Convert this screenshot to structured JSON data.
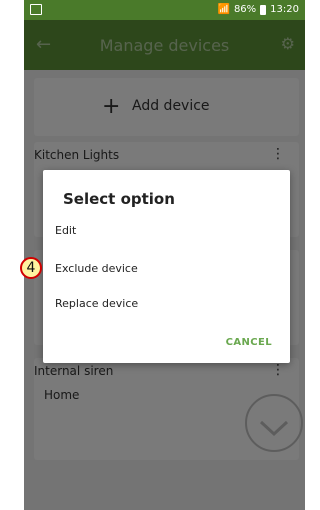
{
  "statusbar": {
    "signal": " .▎",
    "battery_pct": "86%",
    "time": "13:20"
  },
  "appbar": {
    "title": "Manage devices",
    "back_icon": "arrow-back-icon",
    "settings_icon": "gear-icon"
  },
  "add_device": {
    "label": "Add device",
    "icon": "plus-icon"
  },
  "cards": [
    {
      "title": "Kitchen Lights"
    },
    {
      "title": "Internal siren",
      "subtitle": "Home"
    }
  ],
  "dialog": {
    "title": "Select option",
    "options": [
      "Edit",
      "Exclude device",
      "Replace device"
    ],
    "cancel": "CANCEL"
  },
  "annotation": {
    "marker": "4"
  }
}
